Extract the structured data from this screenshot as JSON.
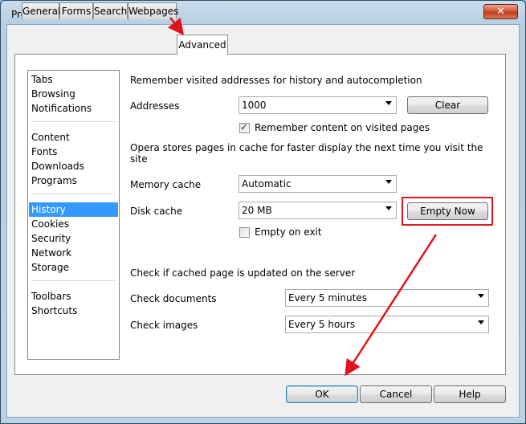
{
  "window": {
    "title": "Preferences",
    "close_glyph": "✕"
  },
  "tabs": [
    "General",
    "Forms",
    "Search",
    "Webpages",
    "Advanced"
  ],
  "sidebar": {
    "groups": [
      [
        "Tabs",
        "Browsing",
        "Notifications"
      ],
      [
        "Content",
        "Fonts",
        "Downloads",
        "Programs"
      ],
      [
        "History",
        "Cookies",
        "Security",
        "Network",
        "Storage"
      ],
      [
        "Toolbars",
        "Shortcuts"
      ]
    ],
    "selected": "History"
  },
  "history": {
    "remember_heading": "Remember visited addresses for history and autocompletion",
    "addresses_label": "Addresses",
    "addresses_value": "1000",
    "clear_label": "Clear",
    "remember_content_label": "Remember content on visited pages",
    "remember_content_checked": true,
    "cache_desc_line1": "Opera stores pages in cache for faster display the next time you visit the",
    "cache_desc_line2": "site",
    "memory_cache_label": "Memory cache",
    "memory_cache_value": "Automatic",
    "disk_cache_label": "Disk cache",
    "disk_cache_value": "20 MB",
    "empty_now_label": "Empty Now",
    "empty_on_exit_label": "Empty on exit",
    "empty_on_exit_checked": false,
    "check_heading": "Check if cached page is updated on the server",
    "check_documents_label": "Check documents",
    "check_documents_value": "Every 5 minutes",
    "check_images_label": "Check images",
    "check_images_value": "Every 5 hours"
  },
  "footer": {
    "ok": "OK",
    "cancel": "Cancel",
    "help": "Help"
  },
  "colors": {
    "annotation": "#e0141c",
    "selection": "#3399ff"
  }
}
